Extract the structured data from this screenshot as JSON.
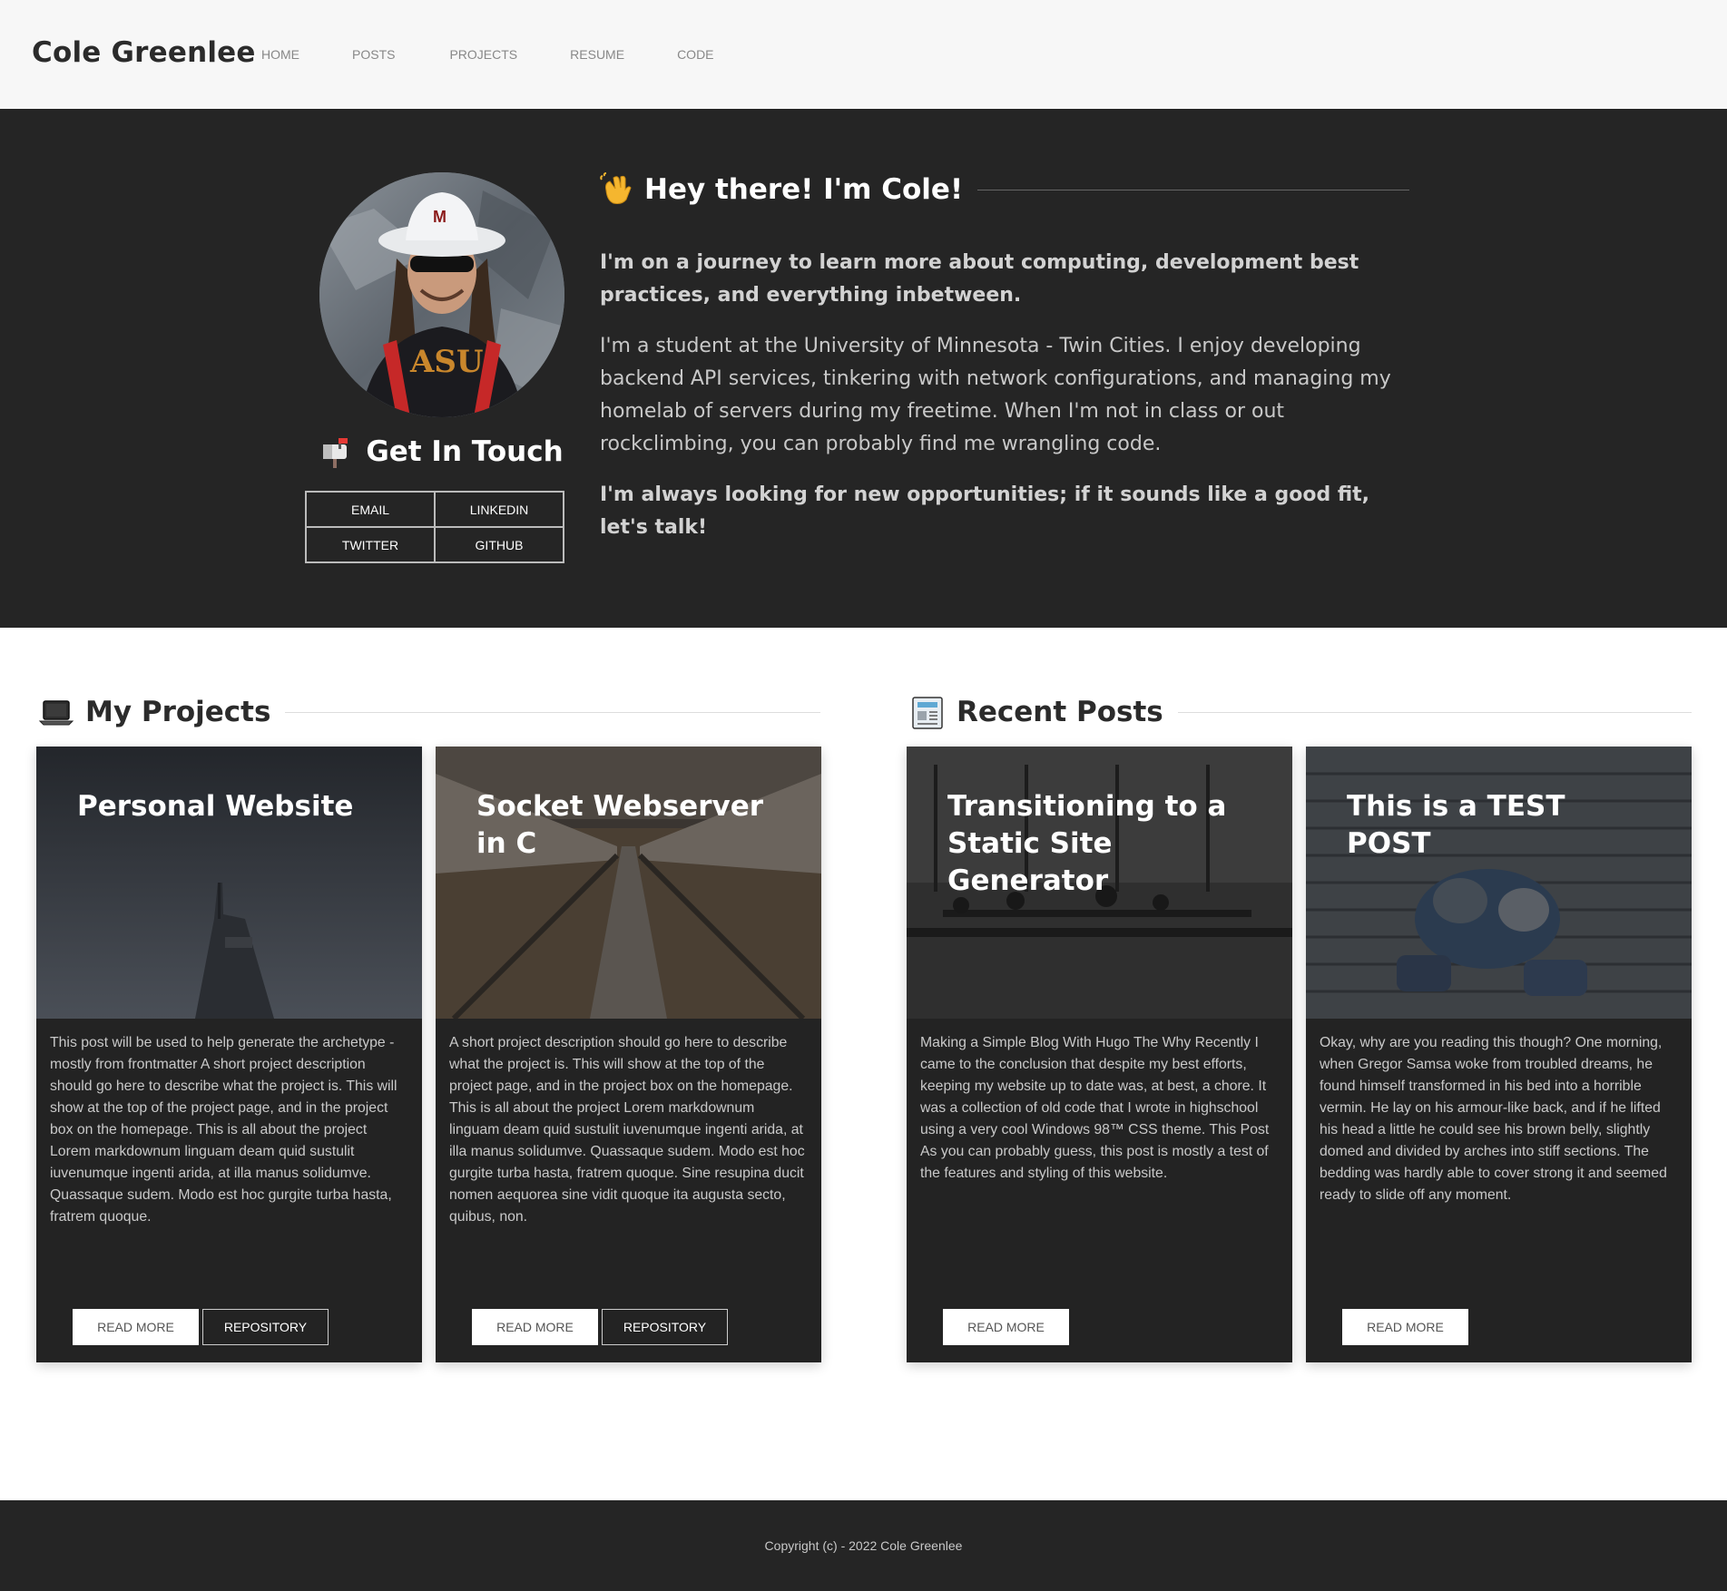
{
  "nav": {
    "brand": "Cole Greenlee",
    "links": [
      "HOME",
      "POSTS",
      "PROJECTS",
      "RESUME",
      "CODE"
    ]
  },
  "hero": {
    "greeting": "Hey there! I'm Cole!",
    "tagline": "I'm on a journey to learn more about computing, development best practices, and everything inbetween.",
    "bio": "I'm a student at the University of Minnesota - Twin Cities. I enjoy developing backend API services, tinkering with network configurations, and managing my homelab of servers during my freetime. When I'm not in class or out rockclimbing, you can probably find me wrangling code.",
    "cta": "I'm always looking for new opportunities; if it sounds like a good fit, let's talk!",
    "touch_title": "Get In Touch",
    "contacts": [
      "EMAIL",
      "LINKEDIN",
      "TWITTER",
      "GITHUB"
    ]
  },
  "projects": {
    "title": "My Projects",
    "items": [
      {
        "title": "Personal Website",
        "desc": "This post will be used to help generate the archetype - mostly from frontmatter A short project description should go here to describe what the project is. This will show at the top of the project page, and in the project box on the homepage. This is all about the project Lorem markdownum linguam deam quid sustulit iuvenumque ingenti arida, at illa manus solidumve. Quassaque sudem. Modo est hoc gurgite turba hasta, fratrem quoque.",
        "read_more": "READ MORE",
        "repo": "REPOSITORY"
      },
      {
        "title": "Socket Webserver in C",
        "desc": "A short project description should go here to describe what the project is. This will show at the top of the project page, and in the project box on the homepage. This is all about the project Lorem markdownum linguam deam quid sustulit iuvenumque ingenti arida, at illa manus solidumve. Quassaque sudem. Modo est hoc gurgite turba hasta, fratrem quoque. Sine resupina ducit nomen aequorea sine vidit quoque ita augusta secto, quibus, non.",
        "read_more": "READ MORE",
        "repo": "REPOSITORY"
      }
    ]
  },
  "posts": {
    "title": "Recent Posts",
    "items": [
      {
        "title": "Transitioning to a Static Site Generator",
        "desc": "Making a Simple Blog With Hugo The Why Recently I came to the conclusion that despite my best efforts, keeping my website up to date was, at best, a chore. It was a collection of old code that I wrote in highschool using a very cool Windows 98™ CSS theme. This Post As you can probably guess, this post is mostly a test of the features and styling of this website.",
        "read_more": "READ MORE"
      },
      {
        "title": "This is a TEST POST",
        "desc": "Okay, why are you reading this though? One morning, when Gregor Samsa woke from troubled dreams, he found himself transformed in his bed into a horrible vermin. He lay on his armour-like back, and if he lifted his head a little he could see his brown belly, slightly domed and divided by arches into stiff sections. The bedding was hardly able to cover strong it and seemed ready to slide off any moment.",
        "read_more": "READ MORE"
      }
    ]
  },
  "footer": {
    "copyright": "Copyright (c) - 2022 Cole Greenlee"
  }
}
